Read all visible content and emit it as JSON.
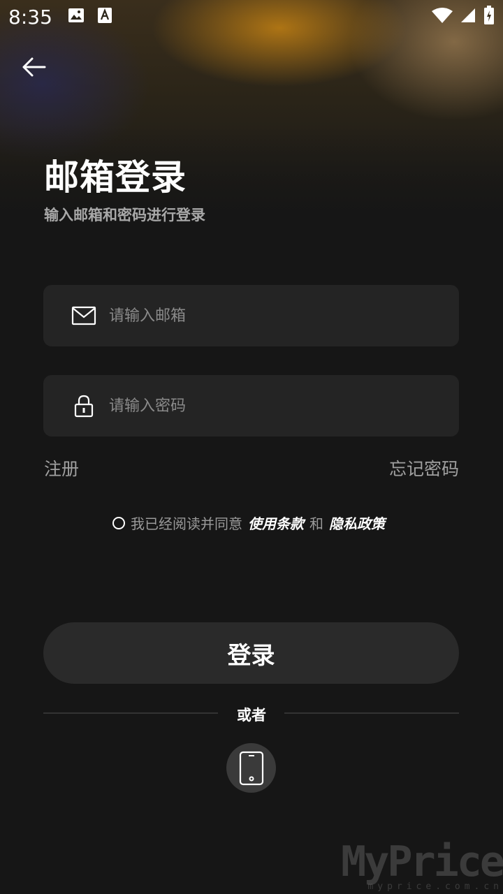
{
  "status_bar": {
    "time": "8:35"
  },
  "header": {
    "title": "邮箱登录",
    "subtitle": "输入邮箱和密码进行登录"
  },
  "form": {
    "email_placeholder": "请输入邮箱",
    "email_value": "",
    "password_placeholder": "请输入密码",
    "password_value": ""
  },
  "links": {
    "register": "注册",
    "forgot_password": "忘记密码"
  },
  "agreement": {
    "prefix": "我已经阅读并同意",
    "terms": "使用条款",
    "and": "和",
    "privacy": "隐私政策"
  },
  "login_button": "登录",
  "or_text": "或者",
  "watermark": {
    "big": "MyPrice",
    "small": "myprice.com.cn"
  }
}
